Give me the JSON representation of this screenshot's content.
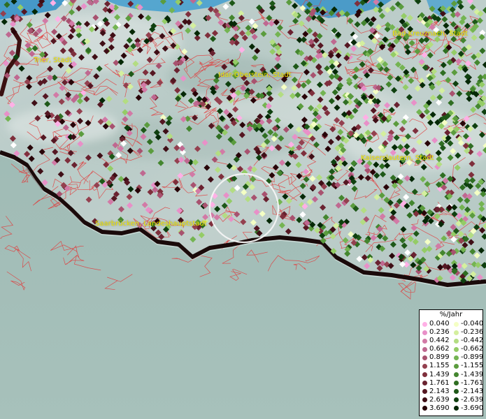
{
  "map": {
    "cities": [
      {
        "name": "Trier, Stadt",
        "key": "trier"
      },
      {
        "name": "Idar-Oberstein, Stadt",
        "key": "idar"
      },
      {
        "name": "Bad Kreuznach, Stadt",
        "key": "kreuznach"
      },
      {
        "name": "Kaiserslautern, Stadt",
        "key": "kaiserslautern"
      },
      {
        "name": "Saarbrücken, Landeshauptstadt",
        "key": "saarbruecken"
      }
    ],
    "colors": {
      "water": "#2f8fc8",
      "boundary": "#e23a3a",
      "coverage_edge": "#1a0a0a",
      "label": "#f2e600"
    },
    "point_seed": 17,
    "point_count": 1500,
    "selection_circle": true
  },
  "legend": {
    "title": "%/Jahr",
    "positive": [
      {
        "value": "0.040",
        "color": "#ffb0e6"
      },
      {
        "value": "0.236",
        "color": "#e890c8"
      },
      {
        "value": "0.442",
        "color": "#d27aa6"
      },
      {
        "value": "0.662",
        "color": "#bf6890"
      },
      {
        "value": "0.899",
        "color": "#a8526f"
      },
      {
        "value": "1.155",
        "color": "#94404f"
      },
      {
        "value": "1.439",
        "color": "#7f2f3c"
      },
      {
        "value": "1.761",
        "color": "#6a2230"
      },
      {
        "value": "2.143",
        "color": "#551722"
      },
      {
        "value": "2.639",
        "color": "#3f0e16"
      },
      {
        "value": "3.690",
        "color": "#280408"
      }
    ],
    "negative": [
      {
        "value": "-0.040",
        "color": "#f4ffc4"
      },
      {
        "value": "-0.236",
        "color": "#d4ef9e"
      },
      {
        "value": "-0.442",
        "color": "#b3dd82"
      },
      {
        "value": "-0.662",
        "color": "#94cc66"
      },
      {
        "value": "-0.899",
        "color": "#74b452"
      },
      {
        "value": "-1.155",
        "color": "#5b9c3e"
      },
      {
        "value": "-1.439",
        "color": "#44862f"
      },
      {
        "value": "-1.761",
        "color": "#2f6e22"
      },
      {
        "value": "-2.143",
        "color": "#1e5818"
      },
      {
        "value": "-2.639",
        "color": "#0f400f"
      },
      {
        "value": "-3.690",
        "color": "#052806"
      }
    ]
  }
}
